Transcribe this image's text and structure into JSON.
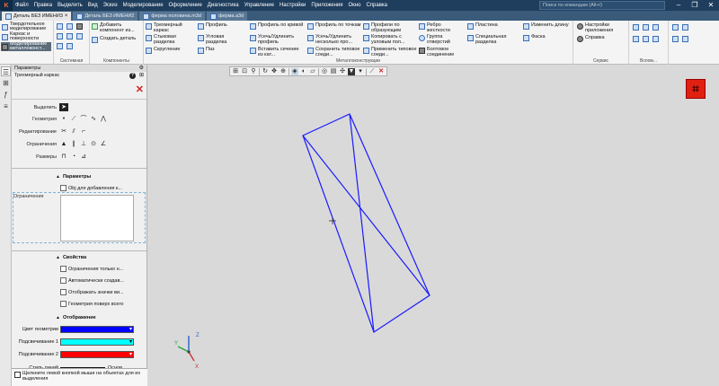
{
  "menubar": {
    "logo": "K",
    "items": [
      "Файл",
      "Правка",
      "Выделить",
      "Вид",
      "Эскиз",
      "Моделирование",
      "Оформление",
      "Диагностика",
      "Управление",
      "Настройки",
      "Приложения",
      "Окно",
      "Справка"
    ],
    "search_placeholder": "Поиск по командам (Alt+/)",
    "minimize": "–",
    "restore": "❐",
    "close": "✕"
  },
  "tabs": [
    {
      "label": "Деталь БЕЗ ИМЕНИ3",
      "active": true
    },
    {
      "label": "Деталь БЕЗ ИМЕНИ2",
      "active": false
    },
    {
      "label": "ферма половина.m3d",
      "active": false
    },
    {
      "label": "ферма.a3d",
      "active": false
    }
  ],
  "ribbon": {
    "modes": [
      "Твердотельное моделирование",
      "Каркас и поверхности",
      "Моделирование металлоконст..."
    ],
    "group_labels": {
      "system": "Системная",
      "components": "Компоненты",
      "metal": "Металлоконструкции",
      "service": "Сервис",
      "aux": "Вспом..."
    },
    "components": {
      "add_component": "Добавить компонент из...",
      "create_part": "Создать деталь"
    },
    "metal": [
      "Трехмерный каркас",
      "Стыковая разделка",
      "Скругление",
      "Профиль",
      "Угловая разделка",
      "Паз",
      "Профиль по кривой",
      "Усечь/Удлинить профиль",
      "Вставить сечение из кат...",
      "Профиль по точкам",
      "Усечь/Удлинить несколько про...",
      "Сохранить типовое соеди...",
      "Профили по образующим",
      "Копировать с узловым пол...",
      "Применить типовое соеди...",
      "Ребро жесткости",
      "Группа отверстий",
      "Болтовое соединение",
      "Пластина",
      "Специальная разделка",
      "Изменить длину",
      "Фаска"
    ],
    "service": {
      "app_settings": "Настройки приложения",
      "help": "Справка"
    }
  },
  "panel": {
    "header": "Параметры",
    "subtitle": "Трехмерный каркас",
    "help": "?",
    "pin": "⊞",
    "close": "✕",
    "rows": {
      "select": "Выделить",
      "geometry": "Геометрия",
      "edit": "Редактирование",
      "constraints": "Ограничения",
      "sizes": "Размеры"
    },
    "params_title": "Параметры",
    "obj_checkbox": "Obj для добавления к...",
    "constraints_label": "Ограничения",
    "props_title": "Свойства",
    "props_checks": [
      "Ограничения только н...",
      "Автоматически создав...",
      "Отображать значки ви...",
      "Геометрия поверх всего"
    ],
    "display_title": "Отображение",
    "color_rows": [
      {
        "label": "Цвет геометрии",
        "color": "#0000ff"
      },
      {
        "label": "Подсвечивание 1",
        "color": "#00ffff"
      },
      {
        "label": "Подсвечивание 2",
        "color": "#ff0000"
      }
    ],
    "line_style_label": "Стиль линий",
    "line_style_value": "Основ..."
  },
  "status_hint": "Щелкните левой кнопкой мыши на объектах для их выделения",
  "triad": {
    "z": "Z",
    "x": "X",
    "y": "Y"
  },
  "colors": {
    "wireframe": "#1a1aff",
    "accent": "#1f3d5c",
    "logo": "#e02010"
  }
}
